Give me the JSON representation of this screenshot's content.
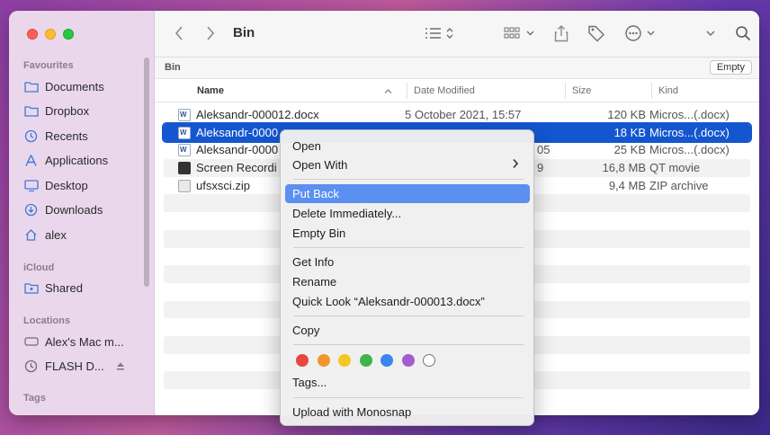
{
  "sidebar": {
    "favourites_label": "Favourites",
    "favourites": [
      {
        "label": "Documents",
        "icon": "folder-icon"
      },
      {
        "label": "Dropbox",
        "icon": "folder-icon"
      },
      {
        "label": "Recents",
        "icon": "clock-icon"
      },
      {
        "label": "Applications",
        "icon": "applications-icon"
      },
      {
        "label": "Desktop",
        "icon": "desktop-icon"
      },
      {
        "label": "Downloads",
        "icon": "download-icon"
      },
      {
        "label": "alex",
        "icon": "home-icon"
      }
    ],
    "icloud_label": "iCloud",
    "icloud": [
      {
        "label": "Shared",
        "icon": "shared-folder-icon"
      }
    ],
    "locations_label": "Locations",
    "locations": [
      {
        "label": "Alex's Mac m...",
        "icon": "drive-icon"
      },
      {
        "label": "FLASH D...",
        "icon": "clock-icon"
      }
    ],
    "tags_label": "Tags"
  },
  "toolbar": {
    "title": "Bin"
  },
  "pathbar": {
    "label": "Bin",
    "empty_button": "Empty"
  },
  "columns": {
    "name": "Name",
    "date": "Date Modified",
    "size": "Size",
    "kind": "Kind"
  },
  "files": [
    {
      "name": "Aleksandr-000012.docx",
      "date": "5 October 2021, 15:57",
      "size": "120 KB",
      "kind": "Micros...(.docx)",
      "icon": "docx"
    },
    {
      "name": "Aleksandr-0000",
      "date": "",
      "size": "18 KB",
      "kind": "Micros...(.docx)",
      "icon": "docx"
    },
    {
      "name": "Aleksandr-0000",
      "date": "05",
      "size": "25 KB",
      "kind": "Micros...(.docx)",
      "icon": "docx"
    },
    {
      "name": "Screen Recordi",
      "date": "9",
      "size": "16,8 MB",
      "kind": "QT movie",
      "icon": "movie"
    },
    {
      "name": "ufsxsci.zip",
      "date": "",
      "size": "9,4 MB",
      "kind": "ZIP archive",
      "icon": "zip"
    }
  ],
  "context_menu": {
    "open": "Open",
    "open_with": "Open With",
    "put_back": "Put Back",
    "delete_immediately": "Delete Immediately...",
    "empty_bin": "Empty Bin",
    "get_info": "Get Info",
    "rename": "Rename",
    "quick_look": "Quick Look “Aleksandr-000013.docx”",
    "copy": "Copy",
    "tags": "Tags...",
    "upload": "Upload with Monosnap",
    "tag_colors": [
      "#e8473e",
      "#f0962d",
      "#f5c723",
      "#3fb449",
      "#3b85f0",
      "#a25ccf",
      "#ffffff"
    ]
  }
}
